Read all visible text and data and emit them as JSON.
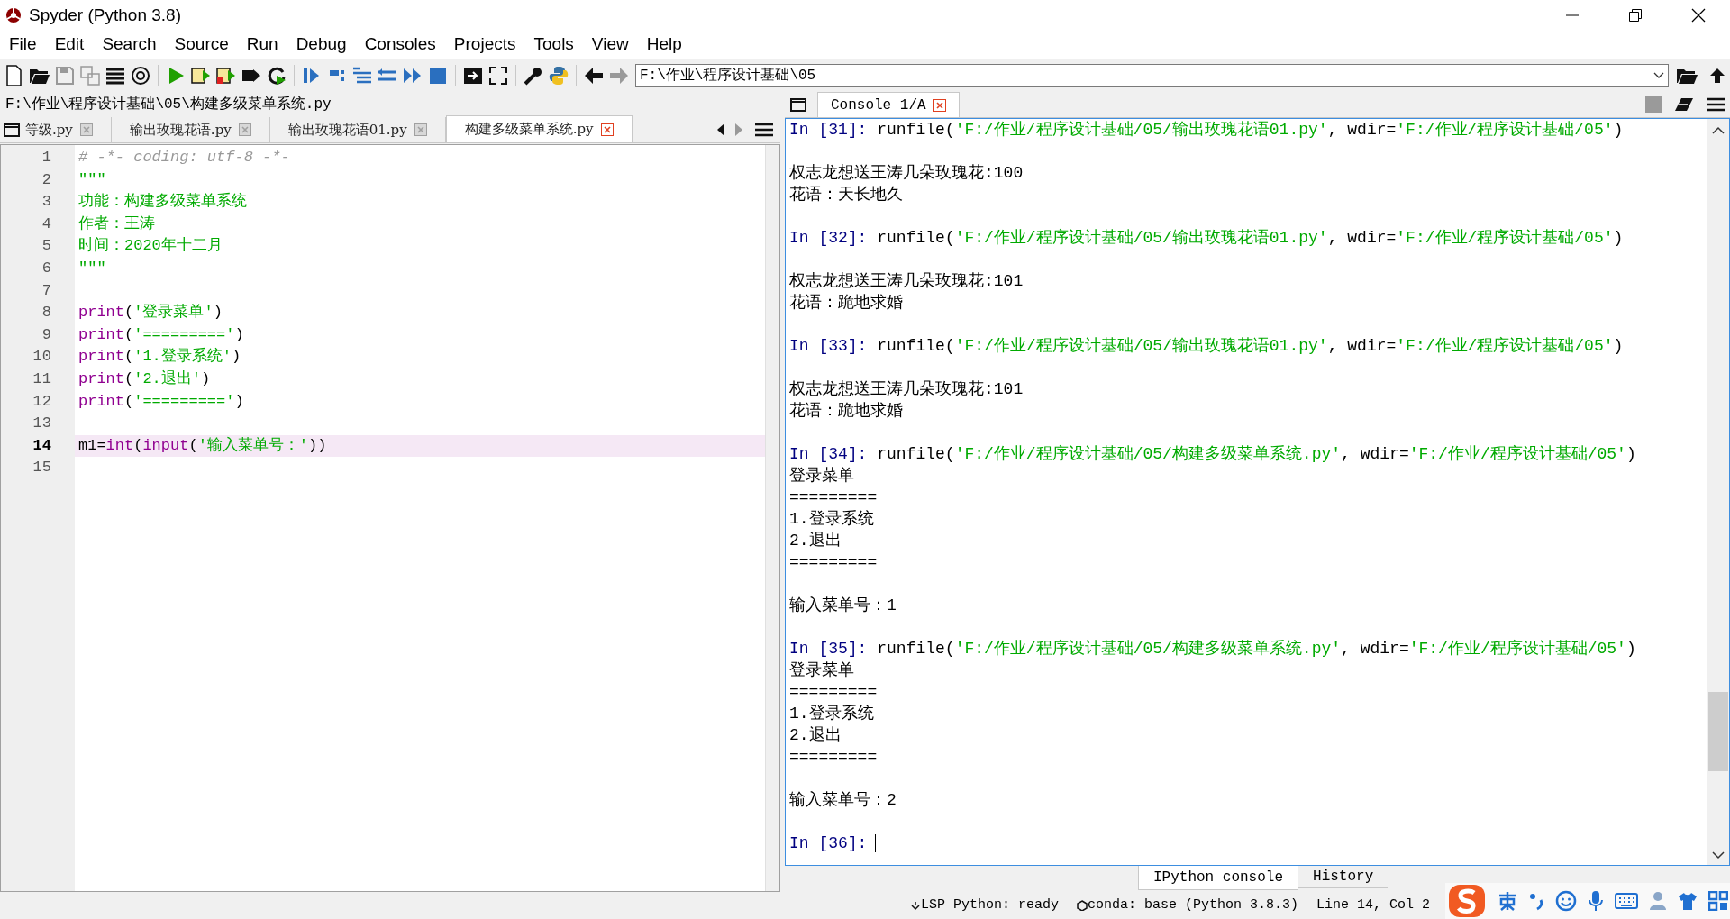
{
  "window": {
    "title": "Spyder (Python 3.8)"
  },
  "menu": [
    "File",
    "Edit",
    "Search",
    "Source",
    "Run",
    "Debug",
    "Consoles",
    "Projects",
    "Tools",
    "View",
    "Help"
  ],
  "toolbar": {
    "path": "F:\\作业\\程序设计基础\\05"
  },
  "editor": {
    "file_path": "F:\\作业\\程序设计基础\\05\\构建多级菜单系统.py",
    "tabs": [
      {
        "label": "等级.py",
        "selected": false
      },
      {
        "label": "输出玫瑰花语.py",
        "selected": false
      },
      {
        "label": "输出玫瑰花语01.py",
        "selected": false
      },
      {
        "label": "构建多级菜单系统.py",
        "selected": true
      }
    ],
    "lines": [
      {
        "number": "1",
        "current": false,
        "tokens": [
          {
            "kind": "comment",
            "text": "# -*- coding: utf-8 -*-"
          }
        ]
      },
      {
        "number": "2",
        "current": false,
        "tokens": [
          {
            "kind": "string",
            "text": "\"\"\""
          }
        ]
      },
      {
        "number": "3",
        "current": false,
        "tokens": [
          {
            "kind": "string",
            "text": "功能：构建多级菜单系统"
          }
        ]
      },
      {
        "number": "4",
        "current": false,
        "tokens": [
          {
            "kind": "string",
            "text": "作者：王涛"
          }
        ]
      },
      {
        "number": "5",
        "current": false,
        "tokens": [
          {
            "kind": "string",
            "text": "时间：2020年十二月"
          }
        ]
      },
      {
        "number": "6",
        "current": false,
        "tokens": [
          {
            "kind": "string",
            "text": "\"\"\""
          }
        ]
      },
      {
        "number": "7",
        "current": false
      },
      {
        "number": "8",
        "current": false,
        "tokens": [
          {
            "kind": "builtin",
            "text": "print"
          },
          {
            "kind": "plain",
            "text": "("
          },
          {
            "kind": "string",
            "text": "'登录菜单'"
          },
          {
            "kind": "plain",
            "text": ")"
          }
        ]
      },
      {
        "number": "9",
        "current": false,
        "tokens": [
          {
            "kind": "builtin",
            "text": "print"
          },
          {
            "kind": "plain",
            "text": "("
          },
          {
            "kind": "string",
            "text": "'========='"
          },
          {
            "kind": "plain",
            "text": ")"
          }
        ]
      },
      {
        "number": "10",
        "current": false,
        "tokens": [
          {
            "kind": "builtin",
            "text": "print"
          },
          {
            "kind": "plain",
            "text": "("
          },
          {
            "kind": "string",
            "text": "'1.登录系统'"
          },
          {
            "kind": "plain",
            "text": ")"
          }
        ]
      },
      {
        "number": "11",
        "current": false,
        "tokens": [
          {
            "kind": "builtin",
            "text": "print"
          },
          {
            "kind": "plain",
            "text": "("
          },
          {
            "kind": "string",
            "text": "'2.退出'"
          },
          {
            "kind": "plain",
            "text": ")"
          }
        ]
      },
      {
        "number": "12",
        "current": false,
        "tokens": [
          {
            "kind": "builtin",
            "text": "print"
          },
          {
            "kind": "plain",
            "text": "("
          },
          {
            "kind": "string",
            "text": "'========='"
          },
          {
            "kind": "plain",
            "text": ")"
          }
        ]
      },
      {
        "number": "13",
        "current": false
      },
      {
        "number": "14",
        "current": true,
        "tokens": [
          {
            "kind": "plain",
            "text": "m1="
          },
          {
            "kind": "builtin",
            "text": "int"
          },
          {
            "kind": "plain",
            "text": "("
          },
          {
            "kind": "builtin",
            "text": "input"
          },
          {
            "kind": "plain",
            "text": "("
          },
          {
            "kind": "string",
            "text": "'输入菜单号：'"
          },
          {
            "kind": "plain",
            "text": "))"
          }
        ]
      },
      {
        "number": "15",
        "current": false
      }
    ]
  },
  "console": {
    "tabs": [
      {
        "label": "Console 1/A",
        "selected": true
      }
    ],
    "blocks": [
      {
        "lines": [
          {
            "tokens": [
              {
                "kind": "prompt",
                "text": "In [31]:"
              },
              {
                "kind": "plain",
                "text": " runfile("
              },
              {
                "kind": "string",
                "text": "'F:/作业/程序设计基础/05/输出玫瑰花语01.py'"
              },
              {
                "kind": "plain",
                "text": ", wdir="
              },
              {
                "kind": "string",
                "text": "'F:/作业/程序设计基础/05'"
              },
              {
                "kind": "plain",
                "text": ")"
              }
            ]
          }
        ]
      },
      {
        "lines": [
          {
            "tokens": [
              {
                "kind": "plain",
                "text": "权志龙想送王涛几朵玫瑰花:100"
              }
            ]
          },
          {
            "tokens": [
              {
                "kind": "plain",
                "text": "花语：天长地久"
              }
            ]
          }
        ]
      },
      {
        "lines": [
          {
            "tokens": [
              {
                "kind": "prompt",
                "text": "In [32]:"
              },
              {
                "kind": "plain",
                "text": " runfile("
              },
              {
                "kind": "string",
                "text": "'F:/作业/程序设计基础/05/输出玫瑰花语01.py'"
              },
              {
                "kind": "plain",
                "text": ", wdir="
              },
              {
                "kind": "string",
                "text": "'F:/作业/程序设计基础/05'"
              },
              {
                "kind": "plain",
                "text": ")"
              }
            ]
          }
        ]
      },
      {
        "lines": [
          {
            "tokens": [
              {
                "kind": "plain",
                "text": "权志龙想送王涛几朵玫瑰花:101"
              }
            ]
          },
          {
            "tokens": [
              {
                "kind": "plain",
                "text": "花语：跪地求婚"
              }
            ]
          }
        ]
      },
      {
        "lines": [
          {
            "tokens": [
              {
                "kind": "prompt",
                "text": "In [33]:"
              },
              {
                "kind": "plain",
                "text": " runfile("
              },
              {
                "kind": "string",
                "text": "'F:/作业/程序设计基础/05/输出玫瑰花语01.py'"
              },
              {
                "kind": "plain",
                "text": ", wdir="
              },
              {
                "kind": "string",
                "text": "'F:/作业/程序设计基础/05'"
              },
              {
                "kind": "plain",
                "text": ")"
              }
            ]
          }
        ]
      },
      {
        "lines": [
          {
            "tokens": [
              {
                "kind": "plain",
                "text": "权志龙想送王涛几朵玫瑰花:101"
              }
            ]
          },
          {
            "tokens": [
              {
                "kind": "plain",
                "text": "花语：跪地求婚"
              }
            ]
          }
        ]
      },
      {
        "lines": [
          {
            "tokens": [
              {
                "kind": "prompt",
                "text": "In [34]:"
              },
              {
                "kind": "plain",
                "text": " runfile("
              },
              {
                "kind": "string",
                "text": "'F:/作业/程序设计基础/05/构建多级菜单系统.py'"
              },
              {
                "kind": "plain",
                "text": ", wdir="
              },
              {
                "kind": "string",
                "text": "'F:/作业/程序设计基础/05'"
              },
              {
                "kind": "plain",
                "text": ")"
              }
            ]
          },
          {
            "tokens": [
              {
                "kind": "plain",
                "text": "登录菜单"
              }
            ]
          },
          {
            "tokens": [
              {
                "kind": "plain",
                "text": "========="
              }
            ]
          },
          {
            "tokens": [
              {
                "kind": "plain",
                "text": "1.登录系统"
              }
            ]
          },
          {
            "tokens": [
              {
                "kind": "plain",
                "text": "2.退出"
              }
            ]
          },
          {
            "tokens": [
              {
                "kind": "plain",
                "text": "========="
              }
            ]
          }
        ]
      },
      {
        "lines": [
          {
            "tokens": [
              {
                "kind": "plain",
                "text": "输入菜单号：1"
              }
            ]
          }
        ]
      },
      {
        "lines": [
          {
            "tokens": [
              {
                "kind": "prompt",
                "text": "In [35]:"
              },
              {
                "kind": "plain",
                "text": " runfile("
              },
              {
                "kind": "string",
                "text": "'F:/作业/程序设计基础/05/构建多级菜单系统.py'"
              },
              {
                "kind": "plain",
                "text": ", wdir="
              },
              {
                "kind": "string",
                "text": "'F:/作业/程序设计基础/05'"
              },
              {
                "kind": "plain",
                "text": ")"
              }
            ]
          },
          {
            "tokens": [
              {
                "kind": "plain",
                "text": "登录菜单"
              }
            ]
          },
          {
            "tokens": [
              {
                "kind": "plain",
                "text": "========="
              }
            ]
          },
          {
            "tokens": [
              {
                "kind": "plain",
                "text": "1.登录系统"
              }
            ]
          },
          {
            "tokens": [
              {
                "kind": "plain",
                "text": "2.退出"
              }
            ]
          },
          {
            "tokens": [
              {
                "kind": "plain",
                "text": "========="
              }
            ]
          }
        ]
      },
      {
        "lines": [
          {
            "tokens": [
              {
                "kind": "plain",
                "text": "输入菜单号：2"
              }
            ]
          }
        ]
      },
      {
        "lines": [
          {
            "cursor": true,
            "tokens": [
              {
                "kind": "prompt",
                "text": "In [36]:"
              }
            ]
          }
        ]
      }
    ]
  },
  "bottom_tabs": [
    {
      "label": "IPython console",
      "selected": true
    },
    {
      "label": "History",
      "selected": false
    }
  ],
  "status_bar": [
    {
      "kind": "lsp",
      "text": "LSP Python: ready"
    },
    {
      "kind": "conda",
      "text": "conda: base (Python 3.8.3)"
    },
    {
      "kind": "plain",
      "text": "Line 14, Col 2"
    }
  ]
}
